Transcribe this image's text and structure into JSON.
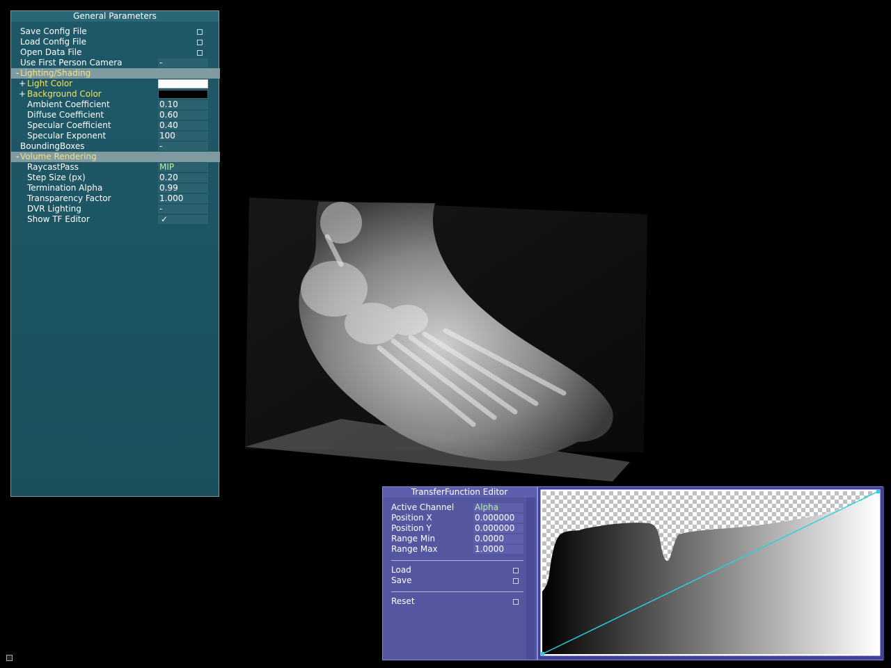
{
  "general_parameters": {
    "title": "General Parameters",
    "rows": [
      {
        "label": "Save Config File"
      },
      {
        "label": "Load Config File"
      },
      {
        "label": "Open Data File"
      },
      {
        "label": "Use First Person Camera",
        "value": "-"
      },
      {
        "label": "Lighting/Shading",
        "sign": "-"
      },
      {
        "label": "Light Color",
        "value_color": "#ffffff"
      },
      {
        "label": "Background Color",
        "value_color": "#000000"
      },
      {
        "label": "Ambient Coefficient",
        "value": "0.10"
      },
      {
        "label": "Diffuse Coefficient",
        "value": "0.60"
      },
      {
        "label": "Specular Coefficient",
        "value": "0.40"
      },
      {
        "label": "Specular Exponent",
        "value": "100"
      },
      {
        "label": "BoundingBoxes",
        "value": "-"
      },
      {
        "label": "Volume Rendering",
        "sign": "-"
      },
      {
        "label": "RaycastPass",
        "value": "MIP"
      },
      {
        "label": "Step Size (px)",
        "value": "0.20"
      },
      {
        "label": "Termination Alpha",
        "value": "0.99"
      },
      {
        "label": "Transparency Factor",
        "value": "1.000"
      },
      {
        "label": "DVR Lighting",
        "value": "-"
      },
      {
        "label": "Show TF Editor",
        "value": "✓"
      }
    ]
  },
  "transfer_function_editor": {
    "title": "TransferFunction Editor",
    "active_channel_label": "Active Channel",
    "active_channel_value": "Alpha",
    "position_x_label": "Position X",
    "position_x_value": "0.000000",
    "position_y_label": "Position Y",
    "position_y_value": "0.000000",
    "range_min_label": "Range Min",
    "range_min_value": "0.0000",
    "range_max_label": "Range Max",
    "range_max_value": "1.0000",
    "load_label": "Load",
    "save_label": "Save",
    "reset_label": "Reset"
  },
  "colors": {
    "panel_teal": "#1d5563",
    "panel_blue": "#4f50a2",
    "tf_line": "#22d3e0",
    "value_highlight_yellow": "#f4e55a"
  }
}
